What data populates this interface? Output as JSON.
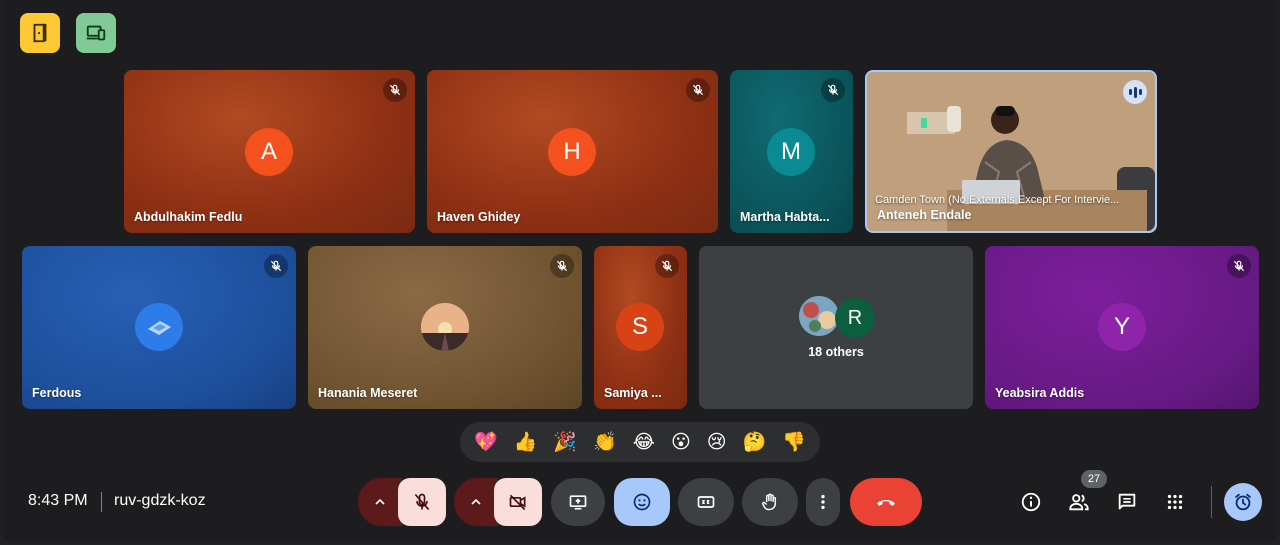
{
  "top_buttons": [
    {
      "icon": "door-icon",
      "color": "#fcc934"
    },
    {
      "icon": "devices-icon",
      "color": "#81c995"
    }
  ],
  "tiles_row1": [
    {
      "name": "Abdulhakim Fedlu",
      "initial": "A",
      "avatar_color": "#f4511e",
      "muted": true
    },
    {
      "name": "Haven Ghidey",
      "initial": "H",
      "avatar_color": "#f4511e",
      "muted": true
    },
    {
      "name": "Martha Habta...",
      "initial": "M",
      "avatar_color": "#0b8a94",
      "muted": true
    },
    {
      "name": "Anteneh Endale",
      "caption": "Camden Town (No Externals Except For Intervie...",
      "speaking": true
    }
  ],
  "tiles_row2": [
    {
      "name": "Ferdous",
      "avatar_color": "#2d7ce8",
      "muted": true
    },
    {
      "name": "Hanania Meseret",
      "muted": true
    },
    {
      "name": "Samiya ...",
      "initial": "S",
      "avatar_color": "#d84315",
      "muted": true
    },
    {
      "name": "",
      "others_text": "18 others",
      "initial": "R",
      "avatar_color": "#0d5e3f"
    },
    {
      "name": "Yeabsira Addis",
      "initial": "Y",
      "avatar_color": "#8e24aa",
      "muted": true
    }
  ],
  "reactions": [
    "💖",
    "👍",
    "🎉",
    "👏",
    "😂",
    "😮",
    "😢",
    "🤔",
    "👎"
  ],
  "footer": {
    "time": "8:43 PM",
    "meeting_code": "ruv-gdzk-koz",
    "participant_count": "27"
  },
  "colors": {
    "end_call": "#ea4335",
    "active_blue": "#a8c7fa",
    "muted_pink": "#f9dedc"
  }
}
